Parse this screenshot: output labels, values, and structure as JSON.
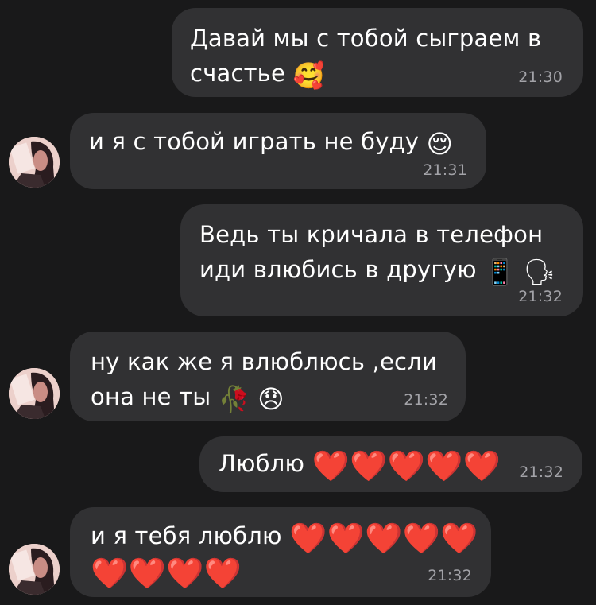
{
  "messages": [
    {
      "side": "out",
      "lines": [
        "Давай мы с тобой сыграем в",
        "счастье"
      ],
      "emoji": [
        "🥰"
      ],
      "time": "21:30"
    },
    {
      "side": "in",
      "lines": [
        "и я с тобой играть не буду"
      ],
      "emoji": [
        "😌"
      ],
      "time": "21:31"
    },
    {
      "side": "out",
      "lines": [
        "Ведь ты кричала в телефон",
        "иди влюбись в другую"
      ],
      "emoji": [
        "📱",
        "🗣"
      ],
      "time": "21:32"
    },
    {
      "side": "in",
      "lines": [
        "ну как же я влюблюсь ,если",
        "она не ты"
      ],
      "emoji": [
        "🥀",
        "😞"
      ],
      "time": "21:32"
    },
    {
      "side": "out",
      "lines": [
        "Люблю"
      ],
      "emoji": [
        "❤️",
        "❤️",
        "❤️",
        "❤️",
        "❤️"
      ],
      "time": "21:32"
    },
    {
      "side": "in",
      "lines": [
        "и я тебя люблю"
      ],
      "emoji": [
        "❤️",
        "❤️",
        "❤️",
        "❤️",
        "❤️",
        "❤️",
        "❤️",
        "❤️",
        "❤️"
      ],
      "time": "21:32"
    }
  ],
  "colors": {
    "background": "#19191a",
    "bubble": "#313133",
    "time": "#a3a3a8",
    "heart": "#e5212e"
  },
  "avatar": {
    "icon": "contact-avatar-photo"
  }
}
